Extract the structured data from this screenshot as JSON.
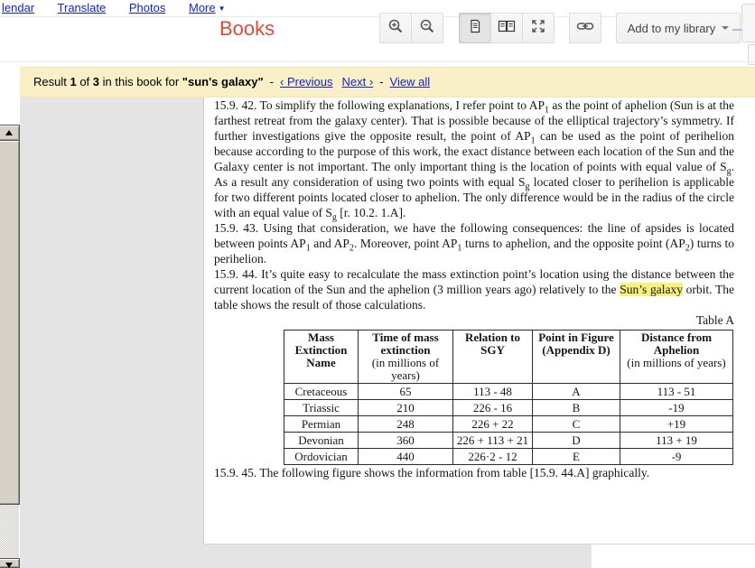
{
  "colors": {
    "accent_red": "#DD4B39",
    "link_blue": "#1122CC",
    "result_bar_bg": "#FAF0C8",
    "highlight_yellow": "#F9F27F",
    "viewer_gray": "#E4E4E4"
  },
  "nav": {
    "links": [
      {
        "label": "lendar"
      },
      {
        "label": "Translate"
      },
      {
        "label": "Photos"
      },
      {
        "label": "More"
      }
    ],
    "more_arrow": "▼"
  },
  "header": {
    "title": "Books"
  },
  "toolbar": {
    "icons": [
      "zoom-in-icon",
      "zoom-out-icon",
      "single-page-icon",
      "two-page-icon",
      "fullscreen-icon",
      "link-icon"
    ],
    "selected_view": "single-page",
    "add_to_library_label": "Add to my library"
  },
  "search_bar": {
    "result_segments": [
      {
        "t": "Result "
      },
      {
        "t": "1",
        "b": true
      },
      {
        "t": " of "
      },
      {
        "t": "3",
        "b": true
      },
      {
        "t": " in this book for "
      },
      {
        "t": "\"sun's galaxy\"",
        "b": true
      }
    ],
    "dash": "-",
    "links": [
      {
        "label": "‹ Previous"
      },
      {
        "label": "Next ›"
      },
      {
        "label": "View all"
      }
    ]
  },
  "page": {
    "p42": [
      {
        "t": "15.9. 42. To simplify the following explanations, I refer point to AP"
      },
      {
        "t": "1",
        "sub": true
      },
      {
        "t": " as the point of aphelion (Sun is at the farthest retreat from the galaxy center). That is possible because of the elliptical trajectory’s symmetry. If further investigations give the opposite result, the point of AP"
      },
      {
        "t": "1",
        "sub": true
      },
      {
        "t": " can be used as the point of perihelion because according to the purpose of this work, the exact distance between each location of the Sun and the Galaxy center is not important. The only important thing is the location of points with equal value of S"
      },
      {
        "t": "g",
        "sub": true
      },
      {
        "t": ". As a result any consideration of using two points with equal S"
      },
      {
        "t": "g",
        "sub": true
      },
      {
        "t": " located closer to perihelion is applicable for two different points located closer to aphelion. The only difference would be in the radius  of the circle with an equal value of S"
      },
      {
        "t": "g",
        "sub": true
      },
      {
        "t": " [r. 10.2. 1.A]."
      }
    ],
    "p43": [
      {
        "t": "15.9. 43. Using that consideration, we have the following consequences: the line of apsides is located between points AP"
      },
      {
        "t": "1",
        "sub": true
      },
      {
        "t": " and AP"
      },
      {
        "t": "2",
        "sub": true
      },
      {
        "t": ". Moreover, point AP"
      },
      {
        "t": "1",
        "sub": true
      },
      {
        "t": " turns to aphelion, and the opposite point (AP"
      },
      {
        "t": "2",
        "sub": true
      },
      {
        "t": ") turns to perihelion."
      }
    ],
    "p44": [
      {
        "t": "15.9. 44. It’s quite easy to recalculate the mass extinction point’s location using the distance between the current location of the Sun and the aphelion (3 million years ago) relatively to the "
      },
      {
        "t": "Sun’s galaxy",
        "hl": true
      },
      {
        "t": " orbit. The table shows the result of those calculations."
      }
    ],
    "table_label": "Table A",
    "table": {
      "headers": [
        {
          "bold": "Mass Extinction Name",
          "normal": ""
        },
        {
          "bold": "Time of mass extinction",
          "normal": "(in millions of years)"
        },
        {
          "bold": "Relation to SGY",
          "normal": ""
        },
        {
          "bold": "Point in Figure (Appendix D)",
          "normal": ""
        },
        {
          "bold": "Distance from Aphelion",
          "normal": "(in millions of years)"
        }
      ],
      "rows": [
        [
          "Cretaceous",
          "65",
          "113 - 48",
          "A",
          "113 - 51"
        ],
        [
          "Triassic",
          "210",
          "226 - 16",
          "B",
          "-19"
        ],
        [
          "Permian",
          "248",
          "226 + 22",
          "C",
          "+19"
        ],
        [
          "Devonian",
          "360",
          "226 + 113 + 21",
          "D",
          "113 + 19"
        ],
        [
          "Ordovician",
          "440",
          "226·2 - 12",
          "E",
          "-9"
        ]
      ]
    },
    "p45": [
      {
        "t": "15.9. 45. The following figure shows the information from table [15.9. 44.A] graphically."
      }
    ]
  }
}
